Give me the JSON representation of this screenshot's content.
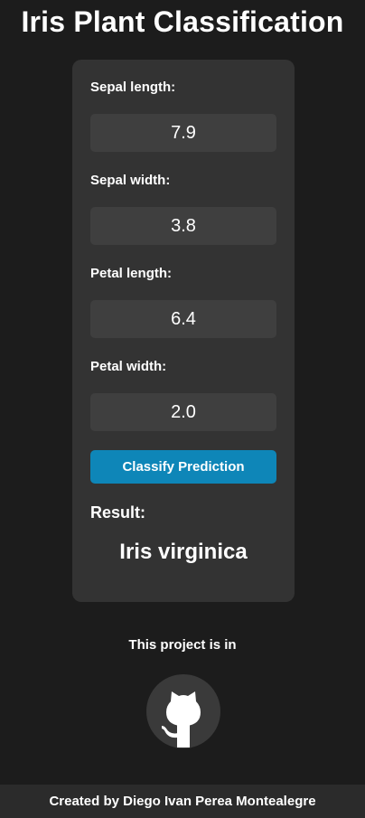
{
  "page": {
    "title": "Iris Plant Classification"
  },
  "form": {
    "sepal_length": {
      "label": "Sepal length:",
      "value": "7.9"
    },
    "sepal_width": {
      "label": "Sepal width:",
      "value": "3.8"
    },
    "petal_length": {
      "label": "Petal length:",
      "value": "6.4"
    },
    "petal_width": {
      "label": "Petal width:",
      "value": "2.0"
    },
    "classify_label": "Classify Prediction"
  },
  "result": {
    "label": "Result:",
    "value": "Iris virginica"
  },
  "project": {
    "text": "This project is in",
    "link_icon": "github-icon"
  },
  "footer": {
    "text": "Created by Diego Ivan Perea Montealegre"
  },
  "colors": {
    "background": "#1c1c1c",
    "card": "#333333",
    "input": "#3f3f3f",
    "button": "#0e86b8",
    "footer": "#2b2b2b"
  }
}
